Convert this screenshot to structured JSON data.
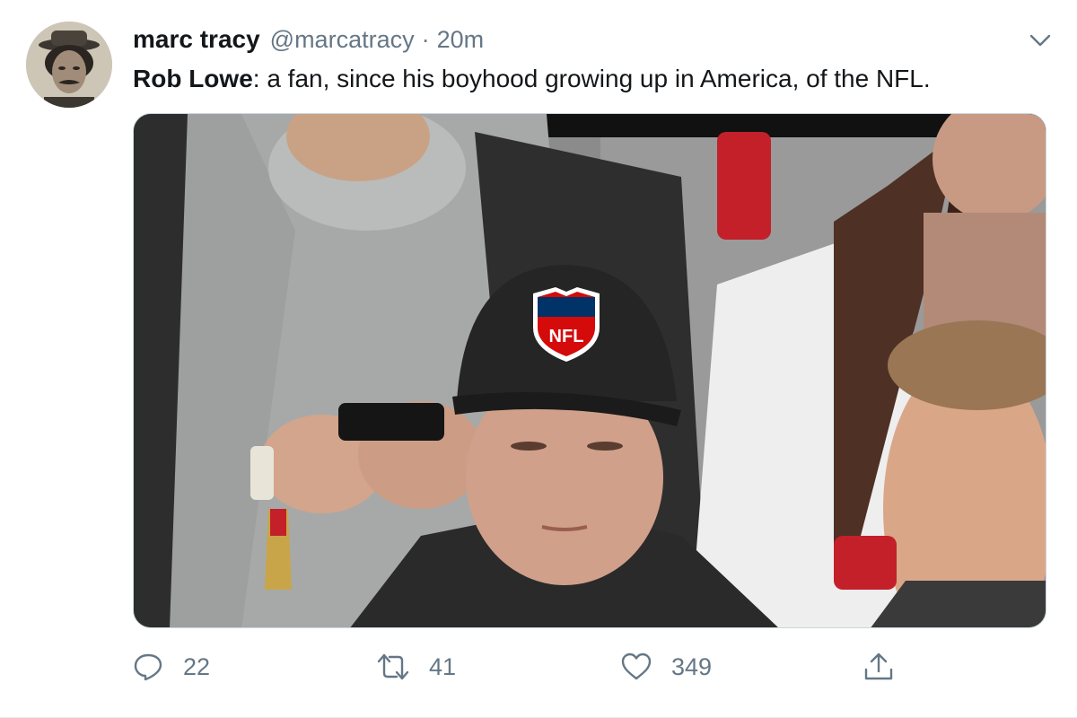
{
  "tweet": {
    "author": {
      "display_name": "marc tracy",
      "handle": "@marcatracy"
    },
    "separator": "·",
    "timestamp": "20m",
    "text_bold": "Rob Lowe",
    "text_rest": ": a fan, since his boyhood growing up in America, of the NFL.",
    "media": {
      "cap_logo_text": "NFL"
    }
  },
  "actions": {
    "reply": {
      "icon": "reply-icon",
      "count": "22"
    },
    "retweet": {
      "icon": "retweet-icon",
      "count": "41"
    },
    "like": {
      "icon": "heart-icon",
      "count": "349"
    },
    "share": {
      "icon": "share-icon"
    }
  },
  "colors": {
    "text_primary": "#14171a",
    "text_secondary": "#657786",
    "border": "#ccd6dd"
  }
}
